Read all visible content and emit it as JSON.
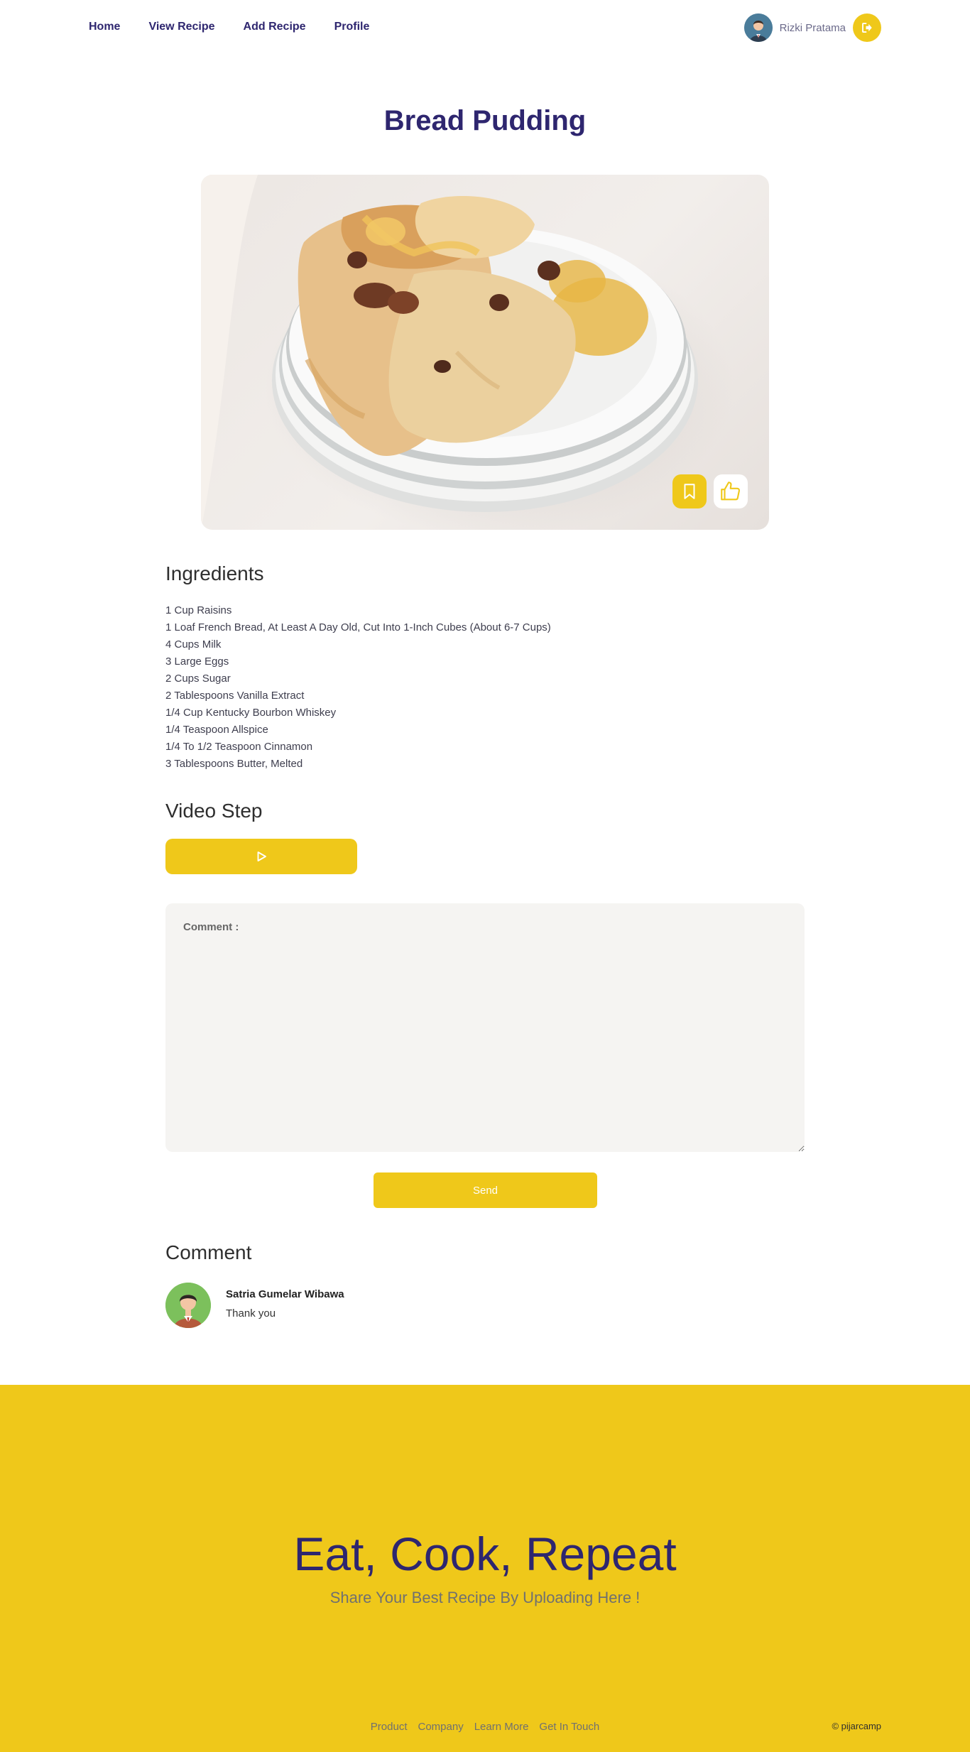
{
  "nav": {
    "links": [
      "Home",
      "View Recipe",
      "Add Recipe",
      "Profile"
    ],
    "user_name": "Rizki Pratama"
  },
  "recipe": {
    "title": "Bread Pudding",
    "ingredients_heading": "Ingredients",
    "ingredients": [
      "1 Cup Raisins",
      "1 Loaf French Bread, At Least A Day Old, Cut Into 1-Inch Cubes (About 6-7 Cups)",
      "4 Cups Milk",
      "3 Large Eggs",
      "2 Cups Sugar",
      "2 Tablespoons Vanilla Extract",
      "1/4 Cup Kentucky Bourbon Whiskey",
      "1/4 Teaspoon Allspice",
      "1/4 To 1/2 Teaspoon Cinnamon",
      "3 Tablespoons Butter, Melted"
    ],
    "video_heading": "Video Step"
  },
  "comment_form": {
    "label": "Comment :",
    "send_label": "Send"
  },
  "comments": {
    "heading": "Comment",
    "items": [
      {
        "name": "Satria Gumelar Wibawa",
        "message": "Thank you"
      }
    ]
  },
  "footer": {
    "title": "Eat, Cook, Repeat",
    "subtitle": "Share Your Best Recipe By Uploading Here !",
    "links": [
      "Product",
      "Company",
      "Learn More",
      "Get In Touch"
    ],
    "copyright": "© pijarcamp"
  },
  "colors": {
    "accent": "#efc81a",
    "brand": "#2e266f"
  },
  "icons": {
    "logout": "logout-icon",
    "save": "bookmark-icon",
    "like": "thumbs-up-icon",
    "video": "play-icon"
  }
}
